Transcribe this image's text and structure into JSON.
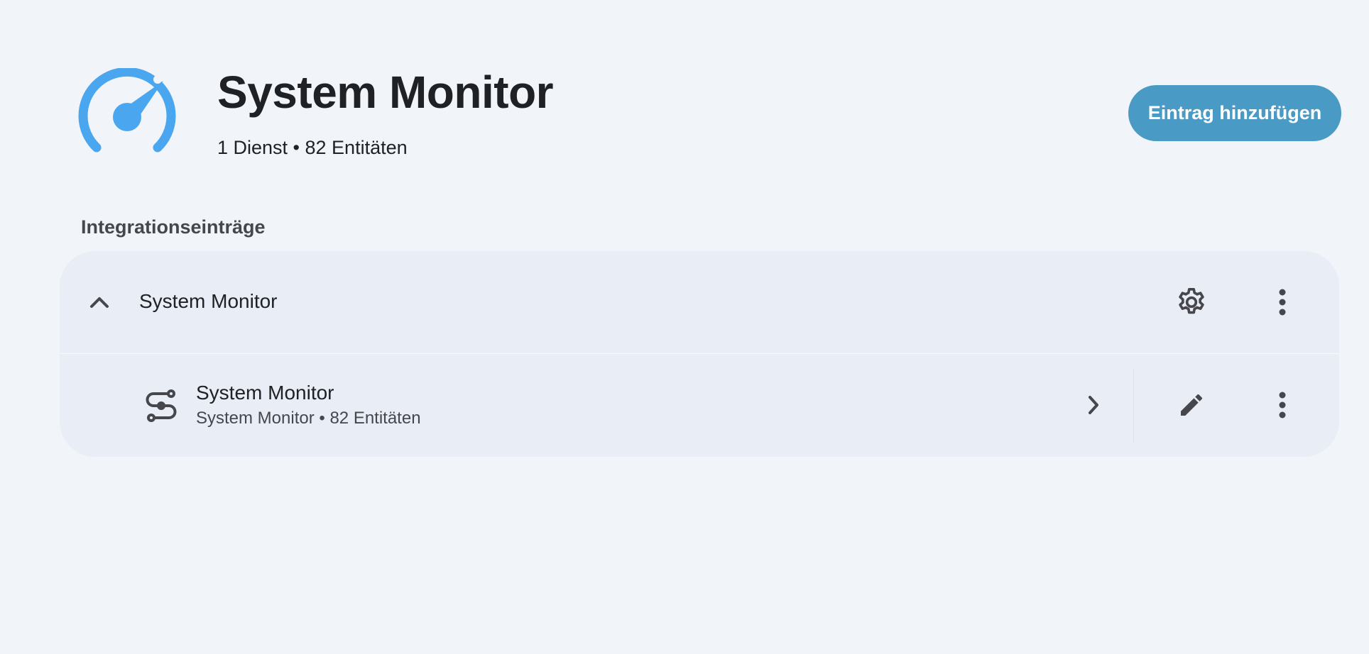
{
  "header": {
    "title": "System Monitor",
    "subtitle": "1 Dienst • 82 Entitäten",
    "logo_icon": "speedometer-icon",
    "add_button_label": "Eintrag hinzufügen"
  },
  "entries_section": {
    "heading": "Integrationseinträge",
    "group": {
      "title": "System Monitor",
      "expanded": true,
      "entries": [
        {
          "name": "System Monitor",
          "meta": "System Monitor • 82 Entitäten",
          "icon": "service-route-icon"
        }
      ]
    }
  },
  "colors": {
    "background": "#f1f4f9",
    "card": "#e9edf5",
    "accent_button": "#4a9ac6",
    "logo_blue": "#4aa7ef",
    "icon_gray": "#45474c",
    "text": "#202124"
  }
}
